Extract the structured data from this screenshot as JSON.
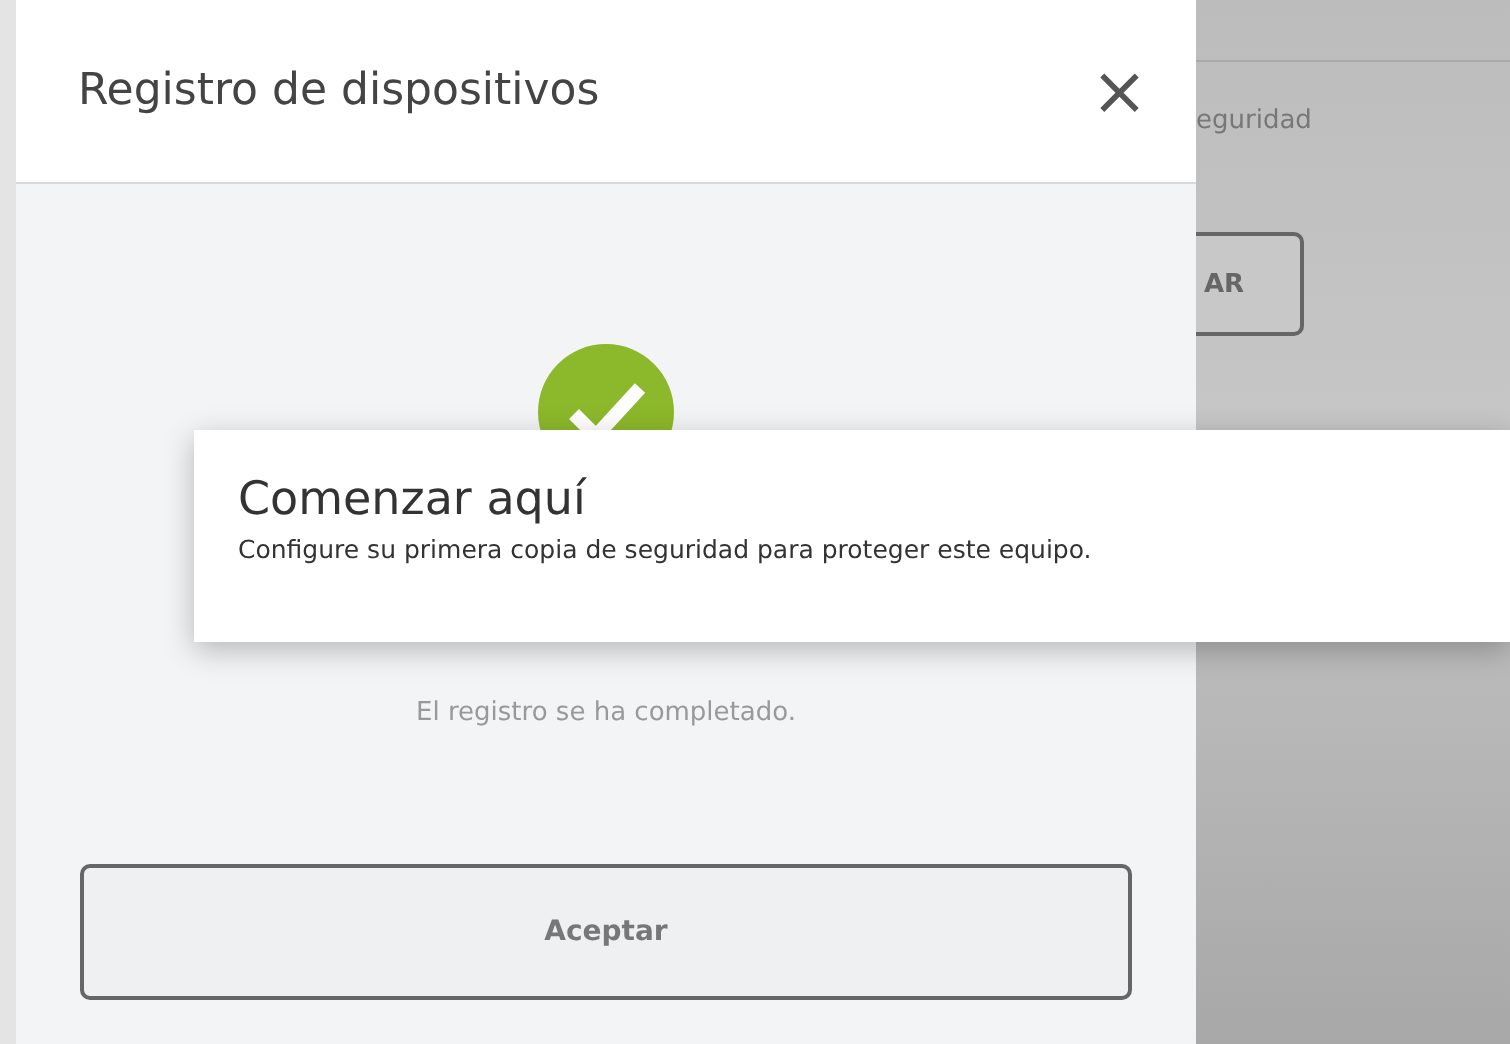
{
  "background": {
    "label": "eguridad",
    "button": "AR"
  },
  "dialog": {
    "title": "Registro de dispositivos",
    "close": "×",
    "status": "El registro se ha completado.",
    "accept_button": "Aceptar"
  },
  "tooltip": {
    "title": "Comenzar aquí",
    "text": "Configure su primera copia de seguridad para proteger este equipo."
  }
}
